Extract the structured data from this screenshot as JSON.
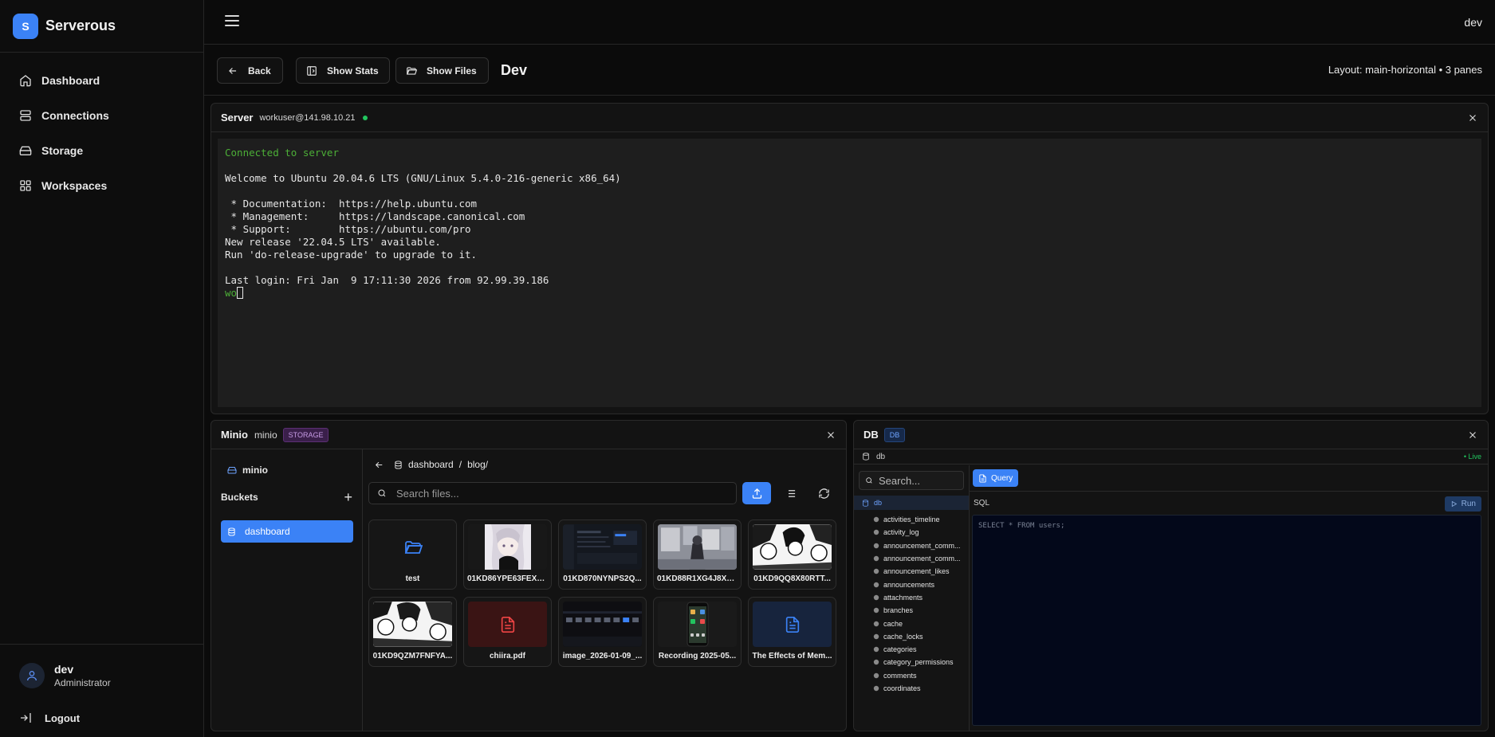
{
  "app": {
    "logo_letter": "S",
    "name": "Serverous",
    "accent": "#3b82f6"
  },
  "nav": [
    {
      "label": "Dashboard",
      "icon": "home-icon"
    },
    {
      "label": "Connections",
      "icon": "server-icon"
    },
    {
      "label": "Storage",
      "icon": "hard-drive-icon"
    },
    {
      "label": "Workspaces",
      "icon": "grid-icon"
    }
  ],
  "user": {
    "name": "dev",
    "role": "Administrator",
    "logout_label": "Logout"
  },
  "topbar": {
    "username": "dev"
  },
  "workspace": {
    "back_label": "Back",
    "stats_label": "Show Stats",
    "files_label": "Show Files",
    "title": "Dev",
    "layout_info": "Layout: main-horizontal • 3 panes"
  },
  "server_panel": {
    "title": "Server",
    "host": "workuser@141.98.10.21",
    "status_color": "#22c55e",
    "terminal": {
      "connected": "Connected to server",
      "welcome": "Welcome to Ubuntu 20.04.6 LTS (GNU/Linux 5.4.0-216-generic x86_64)",
      "docs": " * Documentation:  https://help.ubuntu.com",
      "mgmt": " * Management:     https://landscape.canonical.com",
      "support": " * Support:        https://ubuntu.com/pro",
      "release": "New release '22.04.5 LTS' available.",
      "upgrade": "Run 'do-release-upgrade' to upgrade to it.",
      "last_login": "Last login: Fri Jan  9 17:11:30 2026 from 92.99.39.186",
      "prompt": "wo"
    }
  },
  "minio_panel": {
    "title": "Minio",
    "name": "minio",
    "badge": "STORAGE",
    "sidebar_name": "minio",
    "buckets_label": "Buckets",
    "add_symbol": "+",
    "bucket": "dashboard",
    "breadcrumb": {
      "bucket": "dashboard",
      "separator": "/",
      "path": "blog/"
    },
    "search_placeholder": "Search files...",
    "files": [
      {
        "name": "test",
        "kind": "folder"
      },
      {
        "name": "01KD86YPE63FEX6...",
        "kind": "anime"
      },
      {
        "name": "01KD870NYNPS2Q...",
        "kind": "screenshot"
      },
      {
        "name": "01KD88R1XG4J8X5...",
        "kind": "photo"
      },
      {
        "name": "01KD9QQ8X80RTT...",
        "kind": "manga"
      },
      {
        "name": "01KD9QZM7FNFYA...",
        "kind": "manga"
      },
      {
        "name": "chiira.pdf",
        "kind": "pdf"
      },
      {
        "name": "image_2026-01-09_...",
        "kind": "screenshot"
      },
      {
        "name": "Recording 2025-05...",
        "kind": "phone"
      },
      {
        "name": "The Effects of Mem...",
        "kind": "doc"
      }
    ]
  },
  "db_panel": {
    "title": "DB",
    "badge": "DB",
    "connection": "db",
    "live_label": "• Live",
    "search_placeholder": "Search...",
    "database": "db",
    "tables": [
      "activities_timeline",
      "activity_log",
      "announcement_comm...",
      "announcement_comm...",
      "announcement_likes",
      "announcements",
      "attachments",
      "branches",
      "cache",
      "cache_locks",
      "categories",
      "category_permissions",
      "comments",
      "coordinates"
    ],
    "query_tab": "Query",
    "sql_label": "SQL",
    "run_label": "Run",
    "query": "SELECT * FROM users;"
  }
}
